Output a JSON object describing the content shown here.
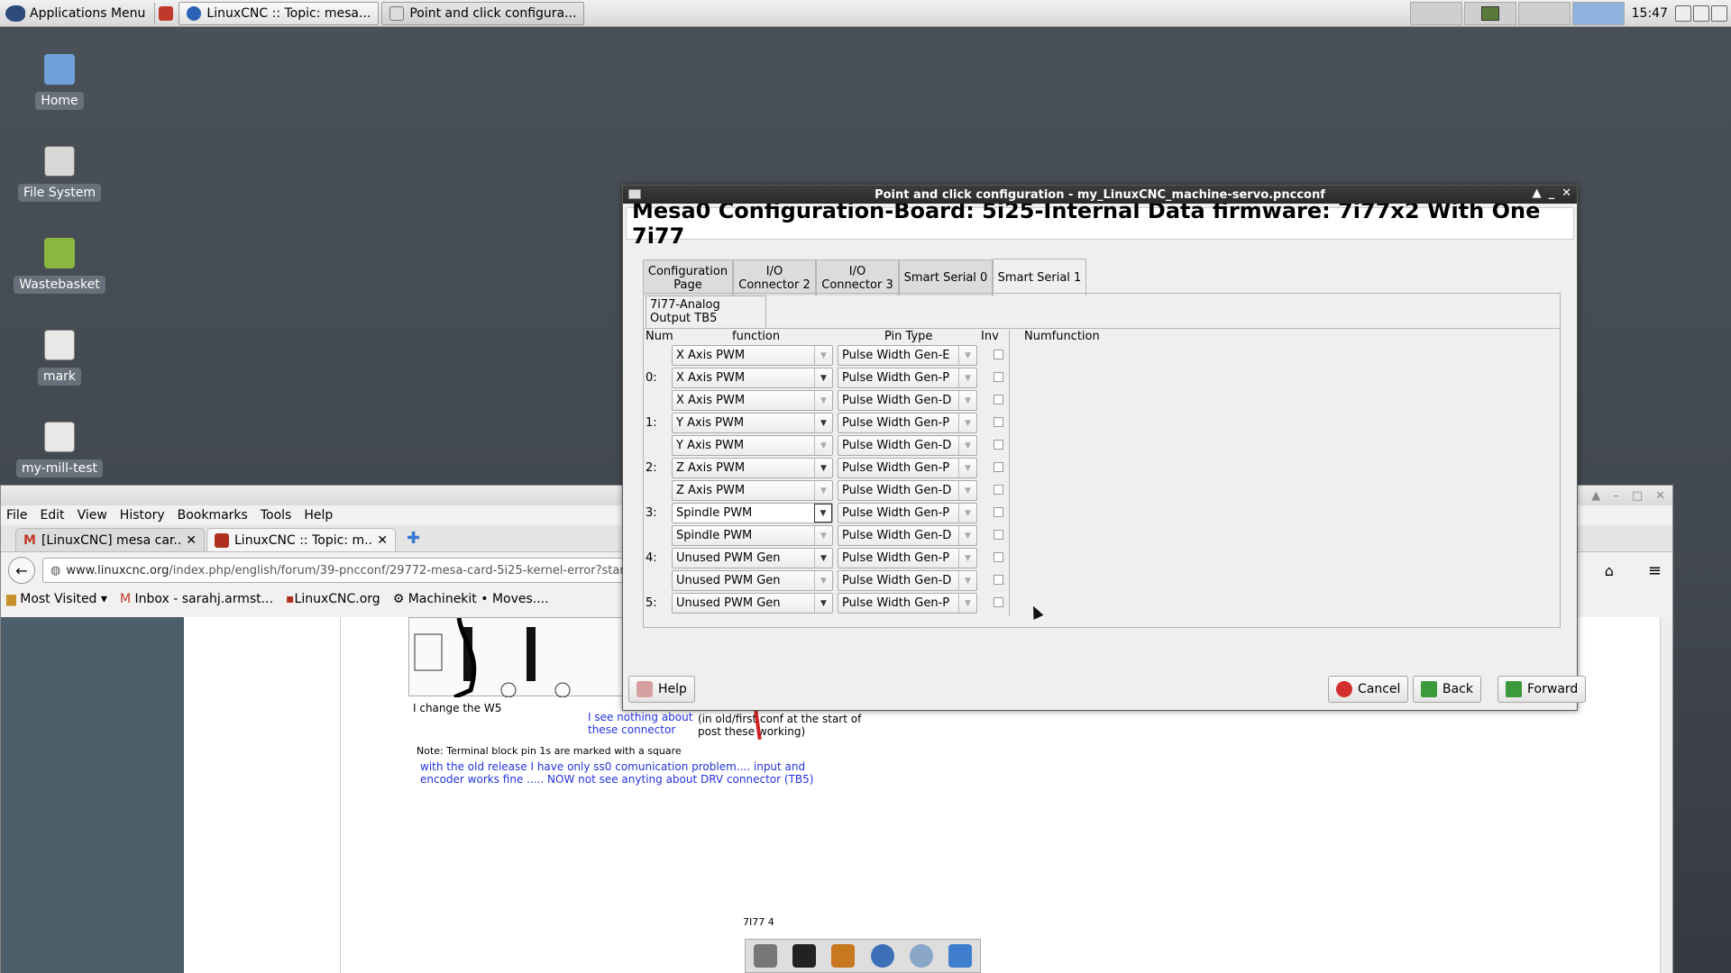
{
  "panel": {
    "app_menu": "Applications Menu",
    "tasks": [
      {
        "label": "LinuxCNC :: Topic: mesa..."
      },
      {
        "label": "Point and click configura..."
      }
    ],
    "clock": "15:47"
  },
  "desktop_icons": [
    {
      "label": "Home",
      "icon": "home-folder-icon"
    },
    {
      "label": "File System",
      "icon": "drive-icon"
    },
    {
      "label": "Wastebasket",
      "icon": "trash-icon"
    },
    {
      "label": "mark",
      "icon": "file-icon"
    },
    {
      "label": "my-mill-test",
      "icon": "file-icon"
    }
  ],
  "browser": {
    "menu": [
      "File",
      "Edit",
      "View",
      "History",
      "Bookmarks",
      "Tools",
      "Help"
    ],
    "tabs": [
      {
        "label": "[LinuxCNC] mesa car..."
      },
      {
        "label": "LinuxCNC :: Topic: m..."
      }
    ],
    "url_domain": "www.linuxcnc.org",
    "url_path": "/index.php/english/forum/39-pncconf/29772-mesa-card-5i25-kernel-error?start=",
    "bookmarks": [
      "Most Visited",
      "Inbox - sarahj.armst...",
      "LinuxCNC.org",
      "Machinekit • Moves...."
    ],
    "page_text": {
      "caption_w5": "I change the W5",
      "see_nothing": "I see nothing about these connector",
      "old_conf": "(in old/first conf at the start of post these working)",
      "note": "Note: Terminal block pin 1s are marked with a square",
      "old_release": "with the old release I have only ss0 comunication problem.... input and encoder works fine ..... NOW not see anyting about DRV connector (TB5)",
      "footer": "7I77   4"
    }
  },
  "dialog": {
    "title": "Point and click configuration - my_LinuxCNC_machine-servo.pncconf",
    "heading": "Mesa0 Configuration-Board: 5i25-Internal Data firmware: 7i77x2 With One 7i77",
    "tabs": [
      "Configuration Page",
      "I/O Connector 2",
      "I/O Connector 3",
      "Smart Serial 0",
      "Smart Serial 1"
    ],
    "subtab": "7i77-Analog Output TB5",
    "headers": {
      "num": "Num",
      "function": "function",
      "pin_type": "Pin Type",
      "inv": "Inv",
      "numfunction": "Numfunction"
    },
    "rows": [
      {
        "num": "",
        "function": "X Axis PWM",
        "pin": "Pulse Width Gen-E"
      },
      {
        "num": "0:",
        "function": "X Axis PWM",
        "pin": "Pulse Width Gen-P"
      },
      {
        "num": "",
        "function": "X Axis PWM",
        "pin": "Pulse Width Gen-D"
      },
      {
        "num": "1:",
        "function": "Y Axis PWM",
        "pin": "Pulse Width Gen-P"
      },
      {
        "num": "",
        "function": "Y Axis PWM",
        "pin": "Pulse Width Gen-D"
      },
      {
        "num": "2:",
        "function": "Z Axis PWM",
        "pin": "Pulse Width Gen-P"
      },
      {
        "num": "",
        "function": "Z Axis PWM",
        "pin": "Pulse Width Gen-D"
      },
      {
        "num": "3:",
        "function": "Spindle PWM",
        "pin": "Pulse Width Gen-P"
      },
      {
        "num": "",
        "function": "Spindle PWM",
        "pin": "Pulse Width Gen-D"
      },
      {
        "num": "4:",
        "function": "Unused PWM Gen",
        "pin": "Pulse Width Gen-P"
      },
      {
        "num": "",
        "function": "Unused PWM Gen",
        "pin": "Pulse Width Gen-D"
      },
      {
        "num": "5:",
        "function": "Unused PWM Gen",
        "pin": "Pulse Width Gen-P"
      }
    ],
    "buttons": {
      "help": "Help",
      "cancel": "Cancel",
      "back": "Back",
      "forward": "Forward"
    }
  }
}
